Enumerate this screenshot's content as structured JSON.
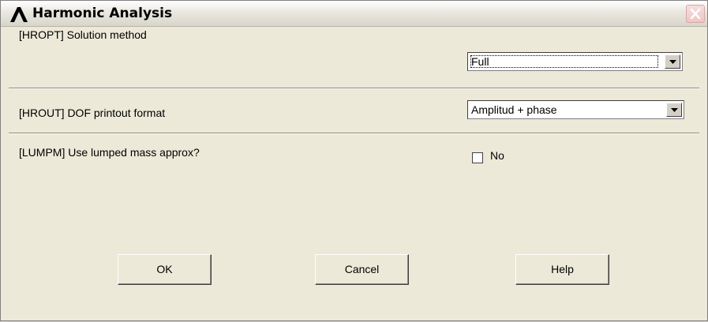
{
  "window": {
    "title": "Harmonic Analysis",
    "logo_icon": "ansys-lambda-icon",
    "close_icon": "close-icon"
  },
  "fields": [
    {
      "label": "[HROPT]  Solution method",
      "value": "Full"
    },
    {
      "label": "[HROUT]  DOF printout format",
      "value": "Amplitud + phase"
    },
    {
      "label": "[LUMPM]  Use lumped mass approx?",
      "checkbox_label": "No",
      "checked": false
    }
  ],
  "buttons": {
    "ok": "OK",
    "cancel": "Cancel",
    "help": "Help"
  },
  "colors": {
    "accent_close": "#e07a7a",
    "dialog_bg": "#ece9d8"
  }
}
